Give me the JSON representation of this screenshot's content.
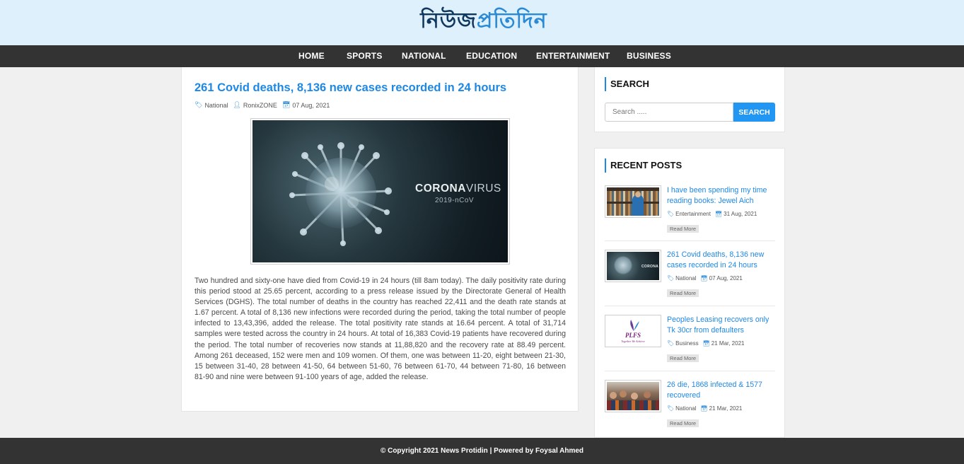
{
  "site": {
    "logo_main": "নিউজ",
    "logo_accent": "প্রতিদিন"
  },
  "nav": {
    "items": [
      {
        "label": "HOME"
      },
      {
        "label": "SPORTS"
      },
      {
        "label": "NATIONAL"
      },
      {
        "label": "EDUCATION"
      },
      {
        "label": "ENTERTAINMENT"
      },
      {
        "label": "BUSINESS"
      }
    ]
  },
  "article": {
    "title": "261 Covid deaths, 8,136 new cases recorded in 24 hours",
    "category": "National",
    "author": "RonixZONE",
    "date": "07 Aug, 2021",
    "image_text_bold": "CORONA",
    "image_text_light": "VIRUS",
    "image_subtext": "2019-nCoV",
    "body": "Two hundred and sixty-one have died from Covid-19 in 24 hours (till 8am today). The daily positivity rate during this period stood at 25.65 percent, according to a press release issued by the Directorate General of Health Services (DGHS). The total number of deaths in the country has reached 22,411 and the death rate stands at 1.67 percent. A total of 8,136 new infections were recorded during the period, taking the total number of people infected to 13,43,396, added the release. The total positivity rate stands at 16.64 percent. A total of 31,714 samples were tested across the country in 24 hours. At total of 16,383 Covid-19 patients have recovered during the period. The total number of recoveries now stands at 11,88,820 and the recovery rate at 88.49 percent. Among 261 deceased, 152 were men and 109 women. Of them, one was between 11-20, eight between 21-30, 15 between 31-40, 28 between 41-50, 64 between 51-60, 76 between 61-70, 44 between 71-80, 16 between 81-90 and nine were between 91-100 years of age, added the release."
  },
  "search_widget": {
    "title": "SEARCH",
    "placeholder": "Search .....",
    "button_label": "SEARCH"
  },
  "recent_widget": {
    "title": "RECENT POSTS",
    "read_more_label": "Read More",
    "posts": [
      {
        "title": "I have been spending my time reading books: Jewel Aich",
        "category": "Entertainment",
        "date": "31 Aug, 2021"
      },
      {
        "title": "261 Covid deaths, 8,136 new cases recorded in 24 hours",
        "category": "National",
        "date": "07 Aug, 2021"
      },
      {
        "title": "Peoples Leasing recovers only Tk 30cr from defaulters",
        "category": "Business",
        "date": "21 Mar, 2021",
        "logo_text": "PLFS",
        "logo_tagline": "Together We Achieve"
      },
      {
        "title": "26 die, 1868 infected & 1577 recovered",
        "category": "National",
        "date": "21 Mar, 2021"
      }
    ]
  },
  "footer": {
    "text": "© Copyright 2021 News Protidin | Powered by Foysal Ahmed"
  },
  "colors": {
    "accent": "#1e88e5",
    "nav_bg": "#333333",
    "masthead_bg": "#dff0fd"
  }
}
